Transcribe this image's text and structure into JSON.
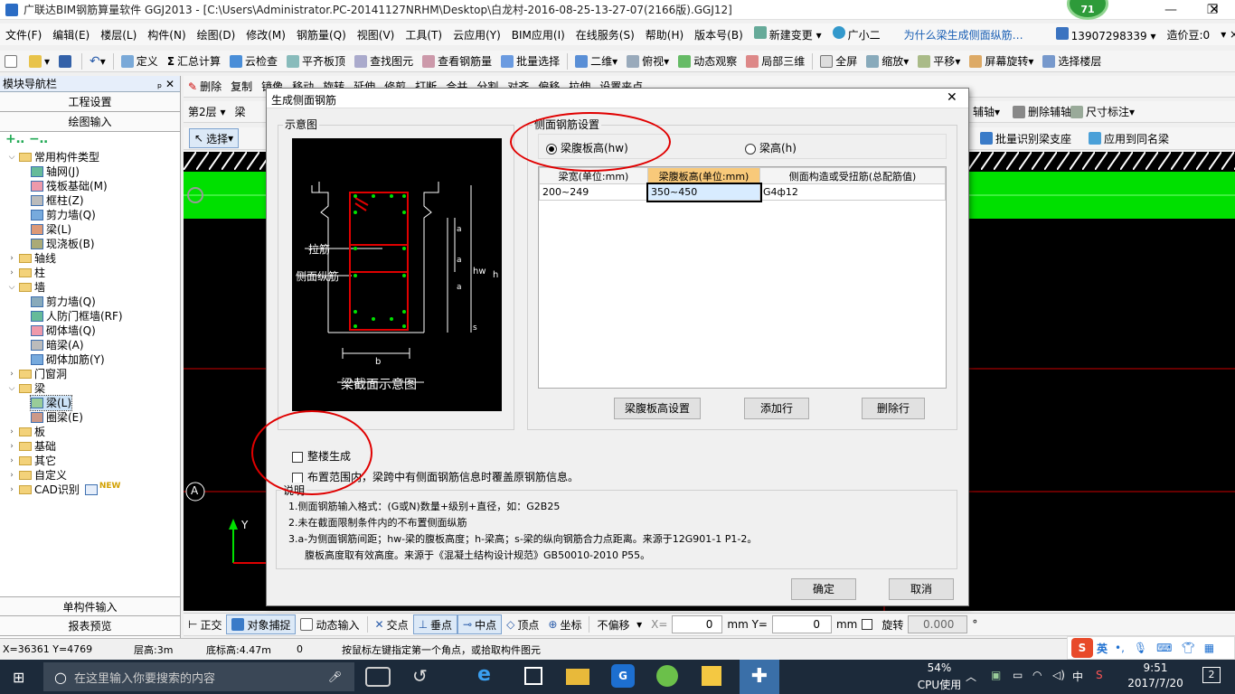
{
  "window": {
    "title": "广联达BIM钢筋算量软件 GGJ2013 - [C:\\Users\\Administrator.PC-20141127NRHM\\Desktop\\白龙村-2016-08-25-13-27-07(2166版).GGJ12]",
    "badge": "71",
    "controls": {
      "minimize": "—",
      "maximize": "❐",
      "close": "✕"
    }
  },
  "menubar": {
    "items": [
      "文件(F)",
      "编辑(E)",
      "楼层(L)",
      "构件(N)",
      "绘图(D)",
      "修改(M)",
      "钢筋量(Q)",
      "视图(V)",
      "工具(T)",
      "云应用(Y)",
      "BIM应用(I)",
      "在线服务(S)",
      "帮助(H)",
      "版本号(B)"
    ],
    "new_change": "新建变更",
    "guangxiaoer": "广小二",
    "question": "为什么梁生成侧面纵筋…",
    "phone": "13907298339",
    "price": "造价豆:0"
  },
  "toolbar1": [
    "定义",
    "汇总计算",
    "云检查",
    "平齐板顶",
    "查找图元",
    "查看钢筋量",
    "批量选择",
    "二维",
    "俯视",
    "动态观察",
    "局部三维",
    "全屏",
    "缩放",
    "平移",
    "屏幕旋转",
    "选择楼层"
  ],
  "toolbar2": [
    "删除",
    "复制",
    "镜像",
    "移动",
    "旋转",
    "延伸",
    "修剪",
    "打断",
    "合并",
    "分割",
    "对齐",
    "偏移",
    "拉伸",
    "设置夹点"
  ],
  "toolbar3": {
    "floor": "第2层",
    "type": "梁",
    "right": [
      "辅轴",
      "删除辅轴",
      "尺寸标注"
    ]
  },
  "toolbar4": {
    "select": "选择",
    "right": [
      "批量识别梁支座",
      "应用到同名梁"
    ]
  },
  "left_panel": {
    "header": "模块导航栏",
    "pin": "ₓ",
    "btn_project": "工程设置",
    "btn_draw": "绘图输入",
    "tree": [
      {
        "label": "常用构件类型",
        "level": 0,
        "kind": "folder",
        "open": true
      },
      {
        "label": "轴网(J)",
        "level": 1,
        "kind": "item"
      },
      {
        "label": "筏板基础(M)",
        "level": 1,
        "kind": "item"
      },
      {
        "label": "框柱(Z)",
        "level": 1,
        "kind": "item"
      },
      {
        "label": "剪力墙(Q)",
        "level": 1,
        "kind": "item"
      },
      {
        "label": "梁(L)",
        "level": 1,
        "kind": "item"
      },
      {
        "label": "现浇板(B)",
        "level": 1,
        "kind": "item"
      },
      {
        "label": "轴线",
        "level": 0,
        "kind": "folder",
        "open": false
      },
      {
        "label": "柱",
        "level": 0,
        "kind": "folder",
        "open": false
      },
      {
        "label": "墙",
        "level": 0,
        "kind": "folder",
        "open": true
      },
      {
        "label": "剪力墙(Q)",
        "level": 1,
        "kind": "item"
      },
      {
        "label": "人防门框墙(RF)",
        "level": 1,
        "kind": "item"
      },
      {
        "label": "砌体墙(Q)",
        "level": 1,
        "kind": "item"
      },
      {
        "label": "暗梁(A)",
        "level": 1,
        "kind": "item"
      },
      {
        "label": "砌体加筋(Y)",
        "level": 1,
        "kind": "item"
      },
      {
        "label": "门窗洞",
        "level": 0,
        "kind": "folder",
        "open": false
      },
      {
        "label": "梁",
        "level": 0,
        "kind": "folder",
        "open": true
      },
      {
        "label": "梁(L)",
        "level": 1,
        "kind": "item",
        "selected": true
      },
      {
        "label": "圈梁(E)",
        "level": 1,
        "kind": "item"
      },
      {
        "label": "板",
        "level": 0,
        "kind": "folder",
        "open": false
      },
      {
        "label": "基础",
        "level": 0,
        "kind": "folder",
        "open": false
      },
      {
        "label": "其它",
        "level": 0,
        "kind": "folder",
        "open": false
      },
      {
        "label": "自定义",
        "level": 0,
        "kind": "folder",
        "open": false
      },
      {
        "label": "CAD识别",
        "level": 0,
        "kind": "folder",
        "open": false,
        "new": "NEW"
      }
    ],
    "btn_single": "单构件输入",
    "btn_report": "报表预览"
  },
  "canvas": {
    "axis_a": "A",
    "axis_y": "Y",
    "axis_x": "X"
  },
  "dialog": {
    "title": "生成侧面钢筋",
    "close": "✕",
    "diagram_group": "示意图",
    "diagram": {
      "tie": "拉筋",
      "side_bar": "侧面纵筋",
      "caption": "梁截面示意图",
      "a": "a",
      "hw": "hw",
      "h": "h",
      "s": "s",
      "b": "b"
    },
    "settings_group": "侧面钢筋设置",
    "radio_hw": "梁腹板高(hw)",
    "radio_h": "梁高(h)",
    "table": {
      "headers": [
        "梁宽(单位:mm)",
        "梁腹板高(单位:mm)",
        "侧面构造或受扭筋(总配筋值)"
      ],
      "rows": [
        [
          "200~249",
          "350~450",
          "G4ф12"
        ]
      ]
    },
    "btn_web_height": "梁腹板高设置",
    "btn_add_row": "添加行",
    "btn_delete_row": "删除行",
    "chk_whole_building": "整楼生成",
    "chk_overwrite": "布置范围内，梁跨中有侧面钢筋信息时覆盖原钢筋信息。",
    "notes_title": "说明",
    "notes": [
      "1.侧面钢筋输入格式：(G或N)数量+级别+直径，如：G2B25",
      "2.未在截面限制条件内的不布置侧面纵筋",
      "3.a-为侧面钢筋间距；hw-梁的腹板高度；h-梁高；s-梁的纵向钢筋合力点距离。来源于12G901-1 P1-2。",
      "腹板高度取有效高度。来源于《混凝土结构设计规范》GB50010-2010 P55。"
    ],
    "btn_ok": "确定",
    "btn_cancel": "取消"
  },
  "snapbar": {
    "items": [
      "正交",
      "对象捕捉",
      "动态输入",
      "交点",
      "垂点",
      "中点",
      "顶点",
      "坐标"
    ],
    "offset": "不偏移",
    "x_label": "X=",
    "x_value": "0",
    "y_label": "mm Y=",
    "y_value": "0",
    "mm": "mm",
    "rotate": "旋转",
    "rotate_value": "0.000",
    "deg": "°"
  },
  "statusbar": {
    "coords": "X=36361 Y=4769",
    "floor_height": "层高:3m",
    "base_height": "底标高:4.47m",
    "zero": "0",
    "hint": "按鼠标左键指定第一个角点，或拾取构件图元"
  },
  "taskbar": {
    "search": "在这里输入你要搜索的内容",
    "cpu_pct": "54%",
    "cpu_label": "CPU使用",
    "ime": "中",
    "time": "9:51",
    "date": "2017/7/20",
    "notif": "2",
    "sogou": "英"
  },
  "colors": {
    "accent": "#0078d7",
    "green": "#00e000",
    "red_annot": "#e00000",
    "canvas": "#000000"
  }
}
